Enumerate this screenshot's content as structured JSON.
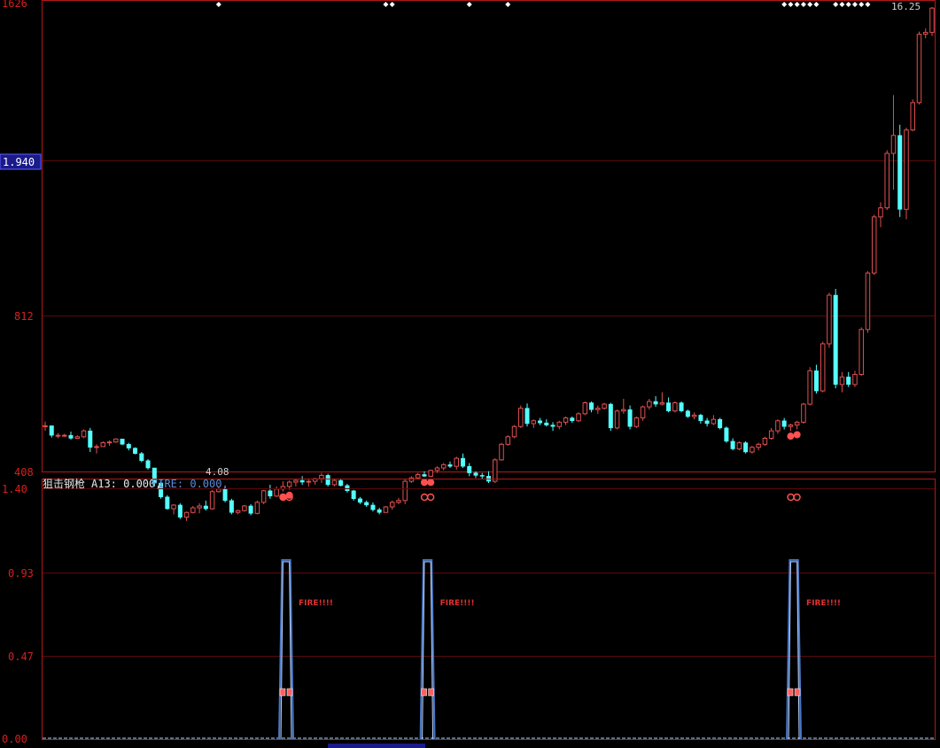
{
  "colors": {
    "background": "#000000",
    "border": "#b01818",
    "grid": "#5a0a0a",
    "up_candle": "#e05050",
    "down_candle": "#54ffff",
    "signal_dot": "#ff5050",
    "fire_line": "#c0d8ff",
    "fire_outline": "#4878c8",
    "price_highlight_bg": "#1a1a8a"
  },
  "price_panel": {
    "axis_labels": [
      "1626",
      "1.940",
      "812",
      "408"
    ],
    "highlight_label": "1.940",
    "min_label": "4.08",
    "peak_label": "16.25"
  },
  "indicator_panel": {
    "title": "狙击钢枪",
    "a13_text": "A13: 0.000,",
    "fire_text": "FIRE: 0.000,",
    "axis_labels": [
      "1.40",
      "0.93",
      "0.47",
      "0.00"
    ],
    "fire_label": "FIRE!!!!"
  },
  "chart_data": [
    {
      "type": "candlestick",
      "y_scale": "log",
      "ylim": [
        4.08,
        16.25
      ],
      "y_tick_labels": [
        "1626",
        "1.940",
        "812",
        "408"
      ],
      "annotations": [
        "4.08",
        "16.25"
      ],
      "markers": "white diamonds at top edge; red dots at buy signals",
      "candles": [
        [
          4.62,
          4.69,
          4.56,
          4.63
        ],
        [
          4.63,
          4.63,
          4.47,
          4.5
        ],
        [
          4.5,
          4.53,
          4.46,
          4.5
        ],
        [
          4.5,
          4.52,
          4.48,
          4.5
        ],
        [
          4.5,
          4.55,
          4.44,
          4.46
        ],
        [
          4.46,
          4.5,
          4.45,
          4.48
        ],
        [
          4.48,
          4.58,
          4.46,
          4.56
        ],
        [
          4.56,
          4.6,
          4.28,
          4.34
        ],
        [
          4.34,
          4.38,
          4.26,
          4.35
        ],
        [
          4.35,
          4.42,
          4.35,
          4.4
        ],
        [
          4.4,
          4.43,
          4.36,
          4.41
        ],
        [
          4.41,
          4.46,
          4.4,
          4.45
        ],
        [
          4.45,
          4.45,
          4.37,
          4.38
        ],
        [
          4.38,
          4.4,
          4.3,
          4.33
        ],
        [
          4.33,
          4.34,
          4.25,
          4.26
        ],
        [
          4.26,
          4.28,
          4.15,
          4.17
        ],
        [
          4.17,
          4.19,
          4.06,
          4.08
        ],
        [
          4.08,
          4.08,
          3.86,
          3.9
        ],
        [
          3.9,
          3.92,
          3.72,
          3.74
        ],
        [
          3.74,
          3.76,
          3.6,
          3.61
        ],
        [
          3.61,
          3.66,
          3.55,
          3.65
        ],
        [
          3.65,
          3.67,
          3.5,
          3.52
        ],
        [
          3.52,
          3.58,
          3.48,
          3.57
        ],
        [
          3.57,
          3.64,
          3.56,
          3.62
        ],
        [
          3.62,
          3.67,
          3.56,
          3.64
        ],
        [
          3.64,
          3.7,
          3.59,
          3.61
        ],
        [
          3.61,
          3.82,
          3.6,
          3.8
        ],
        [
          3.8,
          3.86,
          3.79,
          3.83
        ],
        [
          3.83,
          3.85,
          3.68,
          3.7
        ],
        [
          3.7,
          3.72,
          3.55,
          3.57
        ],
        [
          3.57,
          3.6,
          3.55,
          3.59
        ],
        [
          3.59,
          3.65,
          3.58,
          3.64
        ],
        [
          3.64,
          3.66,
          3.54,
          3.56
        ],
        [
          3.56,
          3.7,
          3.55,
          3.68
        ],
        [
          3.68,
          3.82,
          3.66,
          3.81
        ],
        [
          3.81,
          3.88,
          3.72,
          3.75
        ],
        [
          3.75,
          3.86,
          3.74,
          3.83
        ],
        [
          3.83,
          3.92,
          3.8,
          3.86
        ],
        [
          3.86,
          3.93,
          3.82,
          3.91
        ],
        [
          3.91,
          3.95,
          3.86,
          3.93
        ],
        [
          3.93,
          3.98,
          3.88,
          3.91
        ],
        [
          3.91,
          3.94,
          3.86,
          3.92
        ],
        [
          3.92,
          3.96,
          3.88,
          3.95
        ],
        [
          3.95,
          4.02,
          3.9,
          3.99
        ],
        [
          3.99,
          4.01,
          3.86,
          3.88
        ],
        [
          3.88,
          3.95,
          3.86,
          3.93
        ],
        [
          3.93,
          3.95,
          3.86,
          3.87
        ],
        [
          3.87,
          3.89,
          3.79,
          3.81
        ],
        [
          3.81,
          3.82,
          3.7,
          3.72
        ],
        [
          3.72,
          3.74,
          3.66,
          3.68
        ],
        [
          3.68,
          3.7,
          3.63,
          3.65
        ],
        [
          3.65,
          3.68,
          3.58,
          3.6
        ],
        [
          3.6,
          3.62,
          3.55,
          3.57
        ],
        [
          3.57,
          3.64,
          3.57,
          3.63
        ],
        [
          3.63,
          3.7,
          3.6,
          3.68
        ],
        [
          3.68,
          3.73,
          3.66,
          3.7
        ],
        [
          3.7,
          3.95,
          3.66,
          3.92
        ],
        [
          3.92,
          3.98,
          3.9,
          3.96
        ],
        [
          3.96,
          4.02,
          3.94,
          4.0
        ],
        [
          4.0,
          4.04,
          3.97,
          3.98
        ],
        [
          3.98,
          4.06,
          3.97,
          4.05
        ],
        [
          4.05,
          4.1,
          4.02,
          4.08
        ],
        [
          4.08,
          4.14,
          4.05,
          4.12
        ],
        [
          4.12,
          4.16,
          4.08,
          4.1
        ],
        [
          4.1,
          4.22,
          4.06,
          4.2
        ],
        [
          4.2,
          4.26,
          4.08,
          4.1
        ],
        [
          4.1,
          4.14,
          3.98,
          4.02
        ],
        [
          4.02,
          4.04,
          3.96,
          3.99
        ],
        [
          3.99,
          4.02,
          3.95,
          3.98
        ],
        [
          3.98,
          4.04,
          3.9,
          3.92
        ],
        [
          3.92,
          4.2,
          3.9,
          4.18
        ],
        [
          4.18,
          4.4,
          4.17,
          4.38
        ],
        [
          4.38,
          4.5,
          4.36,
          4.48
        ],
        [
          4.48,
          4.64,
          4.46,
          4.62
        ],
        [
          4.62,
          4.92,
          4.6,
          4.88
        ],
        [
          4.88,
          4.95,
          4.62,
          4.66
        ],
        [
          4.66,
          4.72,
          4.6,
          4.7
        ],
        [
          4.7,
          4.74,
          4.64,
          4.67
        ],
        [
          4.67,
          4.72,
          4.62,
          4.64
        ],
        [
          4.64,
          4.68,
          4.56,
          4.62
        ],
        [
          4.62,
          4.7,
          4.58,
          4.68
        ],
        [
          4.68,
          4.76,
          4.64,
          4.74
        ],
        [
          4.74,
          4.76,
          4.67,
          4.7
        ],
        [
          4.7,
          4.82,
          4.68,
          4.8
        ],
        [
          4.8,
          4.98,
          4.78,
          4.96
        ],
        [
          4.96,
          4.98,
          4.82,
          4.86
        ],
        [
          4.86,
          4.92,
          4.8,
          4.88
        ],
        [
          4.88,
          4.96,
          4.86,
          4.94
        ],
        [
          4.94,
          4.96,
          4.56,
          4.6
        ],
        [
          4.6,
          4.86,
          4.58,
          4.84
        ],
        [
          4.84,
          5.02,
          4.8,
          4.86
        ],
        [
          4.86,
          4.92,
          4.58,
          4.62
        ],
        [
          4.62,
          4.76,
          4.6,
          4.74
        ],
        [
          4.74,
          4.92,
          4.7,
          4.9
        ],
        [
          4.9,
          5.02,
          4.86,
          4.98
        ],
        [
          4.98,
          5.06,
          4.9,
          4.94
        ],
        [
          4.94,
          5.12,
          4.92,
          4.96
        ],
        [
          4.96,
          5.04,
          4.82,
          4.84
        ],
        [
          4.84,
          4.98,
          4.82,
          4.96
        ],
        [
          4.96,
          4.98,
          4.82,
          4.84
        ],
        [
          4.84,
          4.86,
          4.74,
          4.76
        ],
        [
          4.76,
          4.82,
          4.72,
          4.78
        ],
        [
          4.78,
          4.8,
          4.66,
          4.7
        ],
        [
          4.7,
          4.74,
          4.62,
          4.66
        ],
        [
          4.66,
          4.78,
          4.64,
          4.72
        ],
        [
          4.72,
          4.74,
          4.58,
          4.6
        ],
        [
          4.6,
          4.62,
          4.4,
          4.42
        ],
        [
          4.42,
          4.46,
          4.3,
          4.32
        ],
        [
          4.32,
          4.42,
          4.3,
          4.4
        ],
        [
          4.4,
          4.42,
          4.26,
          4.28
        ],
        [
          4.28,
          4.36,
          4.26,
          4.34
        ],
        [
          4.34,
          4.4,
          4.3,
          4.38
        ],
        [
          4.38,
          4.48,
          4.36,
          4.46
        ],
        [
          4.46,
          4.6,
          4.44,
          4.56
        ],
        [
          4.56,
          4.72,
          4.52,
          4.7
        ],
        [
          4.7,
          4.74,
          4.58,
          4.62
        ],
        [
          4.62,
          4.66,
          4.56,
          4.64
        ],
        [
          4.64,
          4.7,
          4.58,
          4.68
        ],
        [
          4.68,
          4.96,
          4.66,
          4.94
        ],
        [
          4.94,
          5.52,
          4.92,
          5.46
        ],
        [
          5.46,
          5.56,
          5.1,
          5.14
        ],
        [
          5.14,
          5.96,
          5.12,
          5.92
        ],
        [
          5.92,
          6.9,
          5.85,
          6.85
        ],
        [
          6.85,
          6.98,
          5.18,
          5.24
        ],
        [
          5.24,
          5.44,
          5.12,
          5.36
        ],
        [
          5.36,
          5.44,
          5.2,
          5.24
        ],
        [
          5.24,
          5.46,
          5.2,
          5.4
        ],
        [
          5.4,
          6.22,
          5.38,
          6.18
        ],
        [
          6.18,
          7.36,
          6.12,
          7.32
        ],
        [
          7.32,
          8.72,
          7.28,
          8.66
        ],
        [
          8.66,
          9.05,
          8.4,
          8.9
        ],
        [
          8.9,
          10.58,
          8.84,
          10.48
        ],
        [
          10.48,
          12.48,
          9.4,
          11.06
        ],
        [
          11.06,
          11.42,
          8.66,
          8.86
        ],
        [
          8.86,
          11.32,
          8.6,
          11.24
        ],
        [
          11.24,
          12.32,
          11.2,
          12.2
        ],
        [
          12.2,
          15.1,
          12.14,
          14.98
        ],
        [
          14.98,
          15.24,
          14.8,
          15.06
        ],
        [
          15.06,
          16.25,
          14.9,
          16.2
        ]
      ]
    },
    {
      "type": "line",
      "title": "狙击钢枪",
      "series": [
        {
          "name": "A13",
          "last_value": 0.0
        },
        {
          "name": "FIRE",
          "last_value": 0.0
        }
      ],
      "ylim": [
        0,
        1.4
      ],
      "y_ticks": [
        0.0,
        0.47,
        0.93,
        1.4
      ],
      "signal_spike_level": 1.0,
      "signal_candle_indices": [
        37,
        59,
        116
      ],
      "annotations": [
        "FIRE!!!!",
        "FIRE!!!!",
        "FIRE!!!!"
      ]
    }
  ]
}
